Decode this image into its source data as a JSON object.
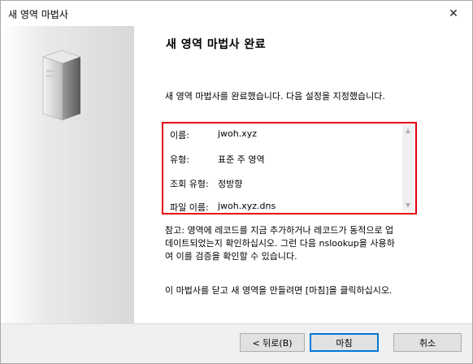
{
  "window": {
    "title": "새 영역 마법사",
    "close_symbol": "✕"
  },
  "page": {
    "title": "새 영역 마법사 완료",
    "description": "새 영역 마법사를 완료했습니다. 다음 설정을 지정했습니다."
  },
  "summary": {
    "rows": [
      {
        "label": "이름:",
        "value": "jwoh.xyz"
      },
      {
        "label": "유형:",
        "value": "표준 주 영역"
      },
      {
        "label": "조회 유형:",
        "value": "정방향"
      },
      {
        "label": "파일 이름:",
        "value": "jwoh.xyz.dns"
      }
    ]
  },
  "note": {
    "line1": "참고: 영역에 레코드를 지금 추가하거나 레코드가 동적으로 업",
    "line2": "데이트되었는지 확인하십시오. 그런 다음 nslookup을 사용하",
    "line3": "여 이를 검증을 확인할 수 있습니다."
  },
  "finish_hint": "이 마법사를 닫고 새 영역을 만들려면 [마침]을 클릭하십시오.",
  "buttons": {
    "back": "< 뒤로(B)",
    "finish": "마침",
    "cancel": "취소"
  }
}
